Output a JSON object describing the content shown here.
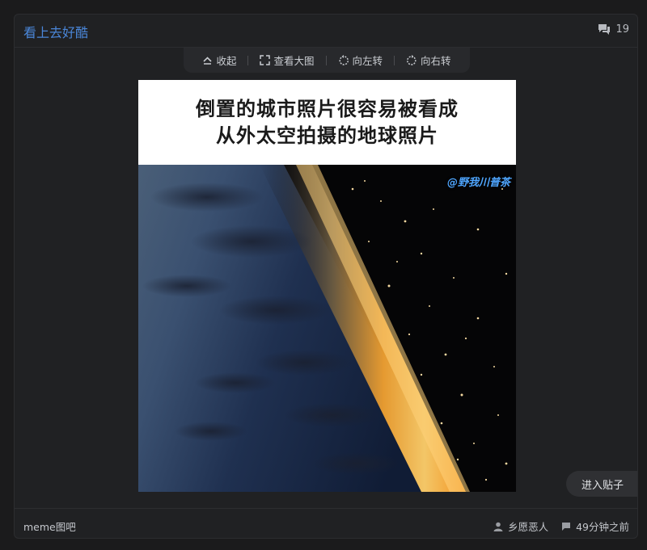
{
  "post": {
    "title": "看上去好酷",
    "comment_count": "19"
  },
  "toolbar": {
    "collapse": "收起",
    "view_large": "查看大图",
    "rotate_left": "向左转",
    "rotate_right": "向右转"
  },
  "image": {
    "caption_line1": "倒置的城市照片很容易被看成",
    "caption_line2": "从外太空拍摄的地球照片",
    "watermark": "@野我川普茶"
  },
  "enter_post": "进入贴子",
  "footer": {
    "forum": "meme图吧",
    "author": "乡愿恶人",
    "time": "49分钟之前"
  },
  "icons": {
    "comment": "comment-bubble-icon",
    "collapse": "collapse-up-icon",
    "expand": "expand-icon",
    "rotate_left": "rotate-left-icon",
    "rotate_right": "rotate-right-icon",
    "user": "user-icon",
    "reply": "reply-bubble-icon"
  },
  "colors": {
    "accent": "#4a86d8",
    "background": "#1b1b1c",
    "card": "#202123"
  }
}
